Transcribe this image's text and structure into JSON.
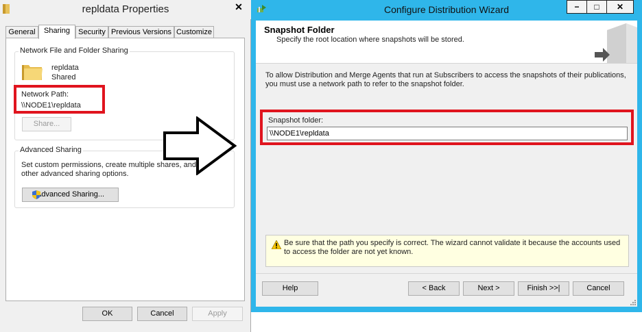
{
  "props_dialog": {
    "title": "repldata Properties",
    "close_glyph": "✕",
    "tabs": [
      "General",
      "Sharing",
      "Security",
      "Previous Versions",
      "Customize"
    ],
    "active_tab": "Sharing",
    "network_sharing": {
      "legend": "Network File and Folder Sharing",
      "folder_name": "repldata",
      "folder_state": "Shared",
      "network_path_label": "Network Path:",
      "network_path_value": "\\\\NODE1\\repldata",
      "share_button": "Share..."
    },
    "advanced_sharing": {
      "legend": "Advanced Sharing",
      "description": "Set custom permissions, create multiple shares, and set other advanced sharing options.",
      "button": "Advanced Sharing..."
    },
    "buttons": {
      "ok": "OK",
      "cancel": "Cancel",
      "apply": "Apply"
    }
  },
  "wizard": {
    "title": "Configure Distribution Wizard",
    "controls": {
      "minimize": "−",
      "maximize": "□",
      "close": "✕"
    },
    "header": {
      "title": "Snapshot Folder",
      "subtitle": "Specify the root location where snapshots will be stored."
    },
    "description": "To allow Distribution and Merge Agents that run at Subscribers to access the snapshots of their publications, you must use a network path to refer to the snapshot folder.",
    "snapshot_folder_label": "Snapshot folder:",
    "snapshot_folder_value": "\\\\NODE1\\repldata",
    "warning": "Be sure that the path you specify is correct. The wizard cannot validate it because the accounts used to access the folder are not yet known.",
    "buttons": {
      "help": "Help",
      "back": "< Back",
      "next": "Next >",
      "finish": "Finish >>|",
      "cancel": "Cancel"
    }
  },
  "colors": {
    "highlight_red": "#e0141e",
    "wizard_frame": "#2fb6ea",
    "warning_background": "#ffffe1"
  },
  "icons": [
    "folder-icon",
    "shield-icon",
    "wizard-icon",
    "warning-icon",
    "arrow-icon",
    "server-icon"
  ]
}
